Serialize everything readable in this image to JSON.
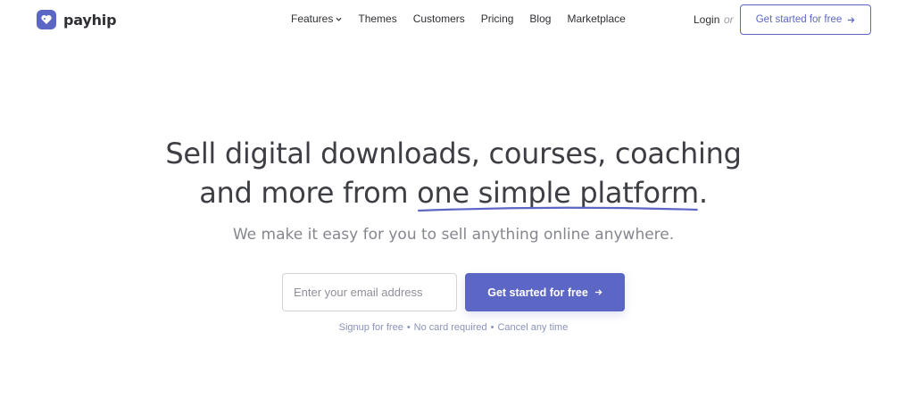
{
  "brand": {
    "name": "payhip",
    "accent": "#5c66c4"
  },
  "nav": {
    "items": [
      {
        "label": "Features",
        "dropdown": true
      },
      {
        "label": "Themes"
      },
      {
        "label": "Customers"
      },
      {
        "label": "Pricing"
      },
      {
        "label": "Blog"
      },
      {
        "label": "Marketplace"
      }
    ],
    "login": "Login",
    "or": "or",
    "cta": "Get started for free",
    "cta_icon": "arrow-right-icon"
  },
  "hero": {
    "headline_line1": "Sell digital downloads, courses, coaching",
    "headline_line2_prefix": "and more from ",
    "headline_highlight": "one simple platform",
    "headline_suffix": ".",
    "subheadline": "We make it easy for you to sell anything online anywhere.",
    "email_placeholder": "Enter your email address",
    "email_value": "",
    "cta": "Get started for free",
    "cta_icon": "arrow-right-icon",
    "fine_print": [
      "Signup for free",
      "No card required",
      "Cancel any time"
    ],
    "separator": "•"
  }
}
